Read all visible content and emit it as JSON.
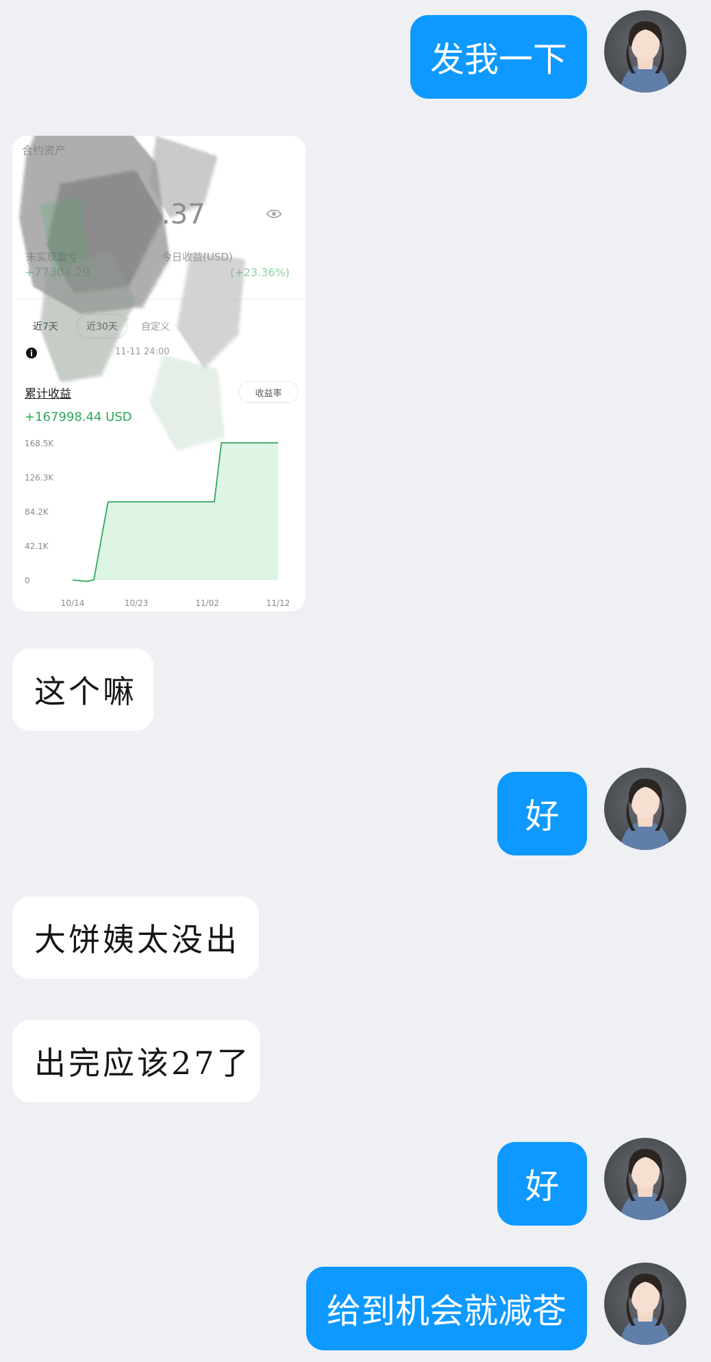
{
  "messages": [
    {
      "side": "me",
      "text": "发我一下"
    },
    {
      "side": "them",
      "type": "image"
    },
    {
      "side": "them",
      "text": "这个嘛"
    },
    {
      "side": "me",
      "text": "好"
    },
    {
      "side": "them",
      "text": "大饼姨太没出"
    },
    {
      "side": "them",
      "text": "出完应该27了"
    },
    {
      "side": "me",
      "text": "好"
    },
    {
      "side": "me",
      "text": "给到机会就减苍"
    }
  ],
  "card": {
    "top_label": "合约资产",
    "balance_fragment": ".37",
    "left_metric_label": "未实现盈亏",
    "left_metric_value": "+77304.29",
    "right_metric_label": "今日收益(USD)",
    "right_metric_value": "(+23.36%)",
    "tabs": [
      "近7天",
      "近30天",
      "自定义"
    ],
    "update_note": "11-11 24:00",
    "cum_label": "累计收益",
    "cum_value": "+167998.44 USD",
    "toggle_label": "收益率",
    "colors": {
      "line": "#2ea85a",
      "fill": "#c8ecd4"
    }
  },
  "chart_data": {
    "type": "area",
    "y_ticks": [
      "168.5K",
      "126.3K",
      "84.2K",
      "42.1K",
      "0"
    ],
    "x_ticks": [
      "10/14",
      "10/23",
      "11/02",
      "11/12"
    ],
    "ylim": [
      0,
      168500
    ],
    "x": [
      "10/14",
      "10/16",
      "10/17",
      "10/19",
      "10/23",
      "10/27",
      "10/31",
      "11/02",
      "11/03",
      "11/04",
      "11/05",
      "11/12"
    ],
    "values": [
      0,
      -2000,
      0,
      96000,
      96000,
      96000,
      96000,
      96000,
      96000,
      168500,
      168500,
      168500
    ]
  }
}
